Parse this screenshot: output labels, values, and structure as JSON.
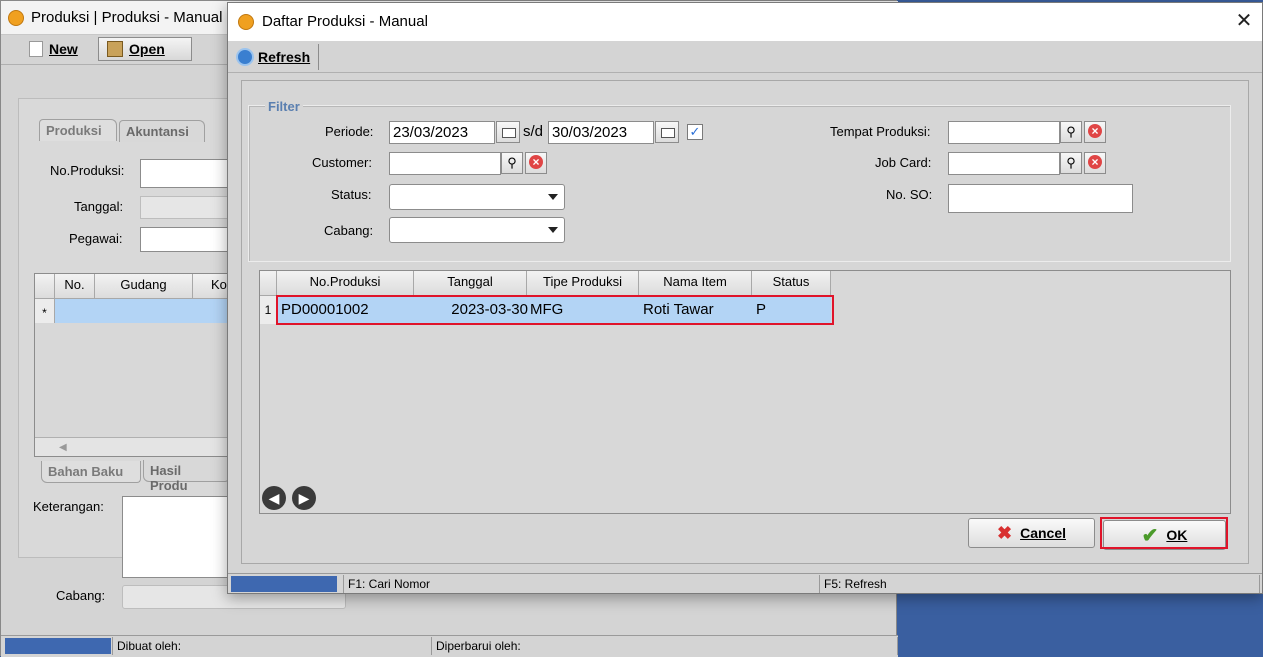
{
  "background_window": {
    "title": "Produksi | Produksi - Manual",
    "toolbar": {
      "new_label": "New",
      "open_label": "Open"
    },
    "tabs": [
      "Produksi",
      "Akuntansi"
    ],
    "labels": {
      "no_produksi": "No.Produksi:",
      "tanggal": "Tanggal:",
      "pegawai": "Pegawai:"
    },
    "grid_headers": [
      "No.",
      "Gudang",
      "Ko"
    ],
    "row_marker": "*",
    "bottom_tabs": [
      "Bahan Baku",
      "Hasil Produ"
    ],
    "keterangan_label": "Keterangan:",
    "cabang_label": "Cabang:",
    "status_bar": [
      "Dibuat oleh:",
      "Diperbarui oleh:"
    ]
  },
  "dialog": {
    "title": "Daftar Produksi - Manual",
    "close_glyph": "✕",
    "refresh_label": "Refresh",
    "filter": {
      "legend": "Filter",
      "periode_label": "Periode:",
      "periode_from": "23/03/2023",
      "sd_label": "s/d",
      "periode_to": "30/03/2023",
      "periode_checked_glyph": "✓",
      "customer_label": "Customer:",
      "customer_value": "",
      "status_label": "Status:",
      "status_value": "",
      "cabang_label": "Cabang:",
      "cabang_value": "",
      "tempat_produksi_label": "Tempat Produksi:",
      "tempat_produksi_value": "",
      "job_card_label": "Job Card:",
      "job_card_value": "",
      "no_so_label": "No. SO:",
      "no_so_value": ""
    },
    "grid": {
      "headers": [
        "No.Produksi",
        "Tanggal",
        "Tipe Produksi",
        "Nama Item",
        "Status"
      ],
      "rows": [
        {
          "num": "1",
          "no_produksi": "PD00001002",
          "tanggal": "2023-03-30",
          "tipe": "MFG",
          "nama_item": "Roti Tawar",
          "status": "P"
        }
      ]
    },
    "buttons": {
      "cancel_label": "Cancel",
      "ok_label": "OK"
    },
    "status_bar": {
      "hint1": "F1: Cari Nomor",
      "hint2": "F5: Refresh"
    },
    "colors": {
      "selected_row": "#b3d4f5",
      "highlight_box": "#e0142a",
      "filter_legend": "#5a7fb0"
    }
  }
}
